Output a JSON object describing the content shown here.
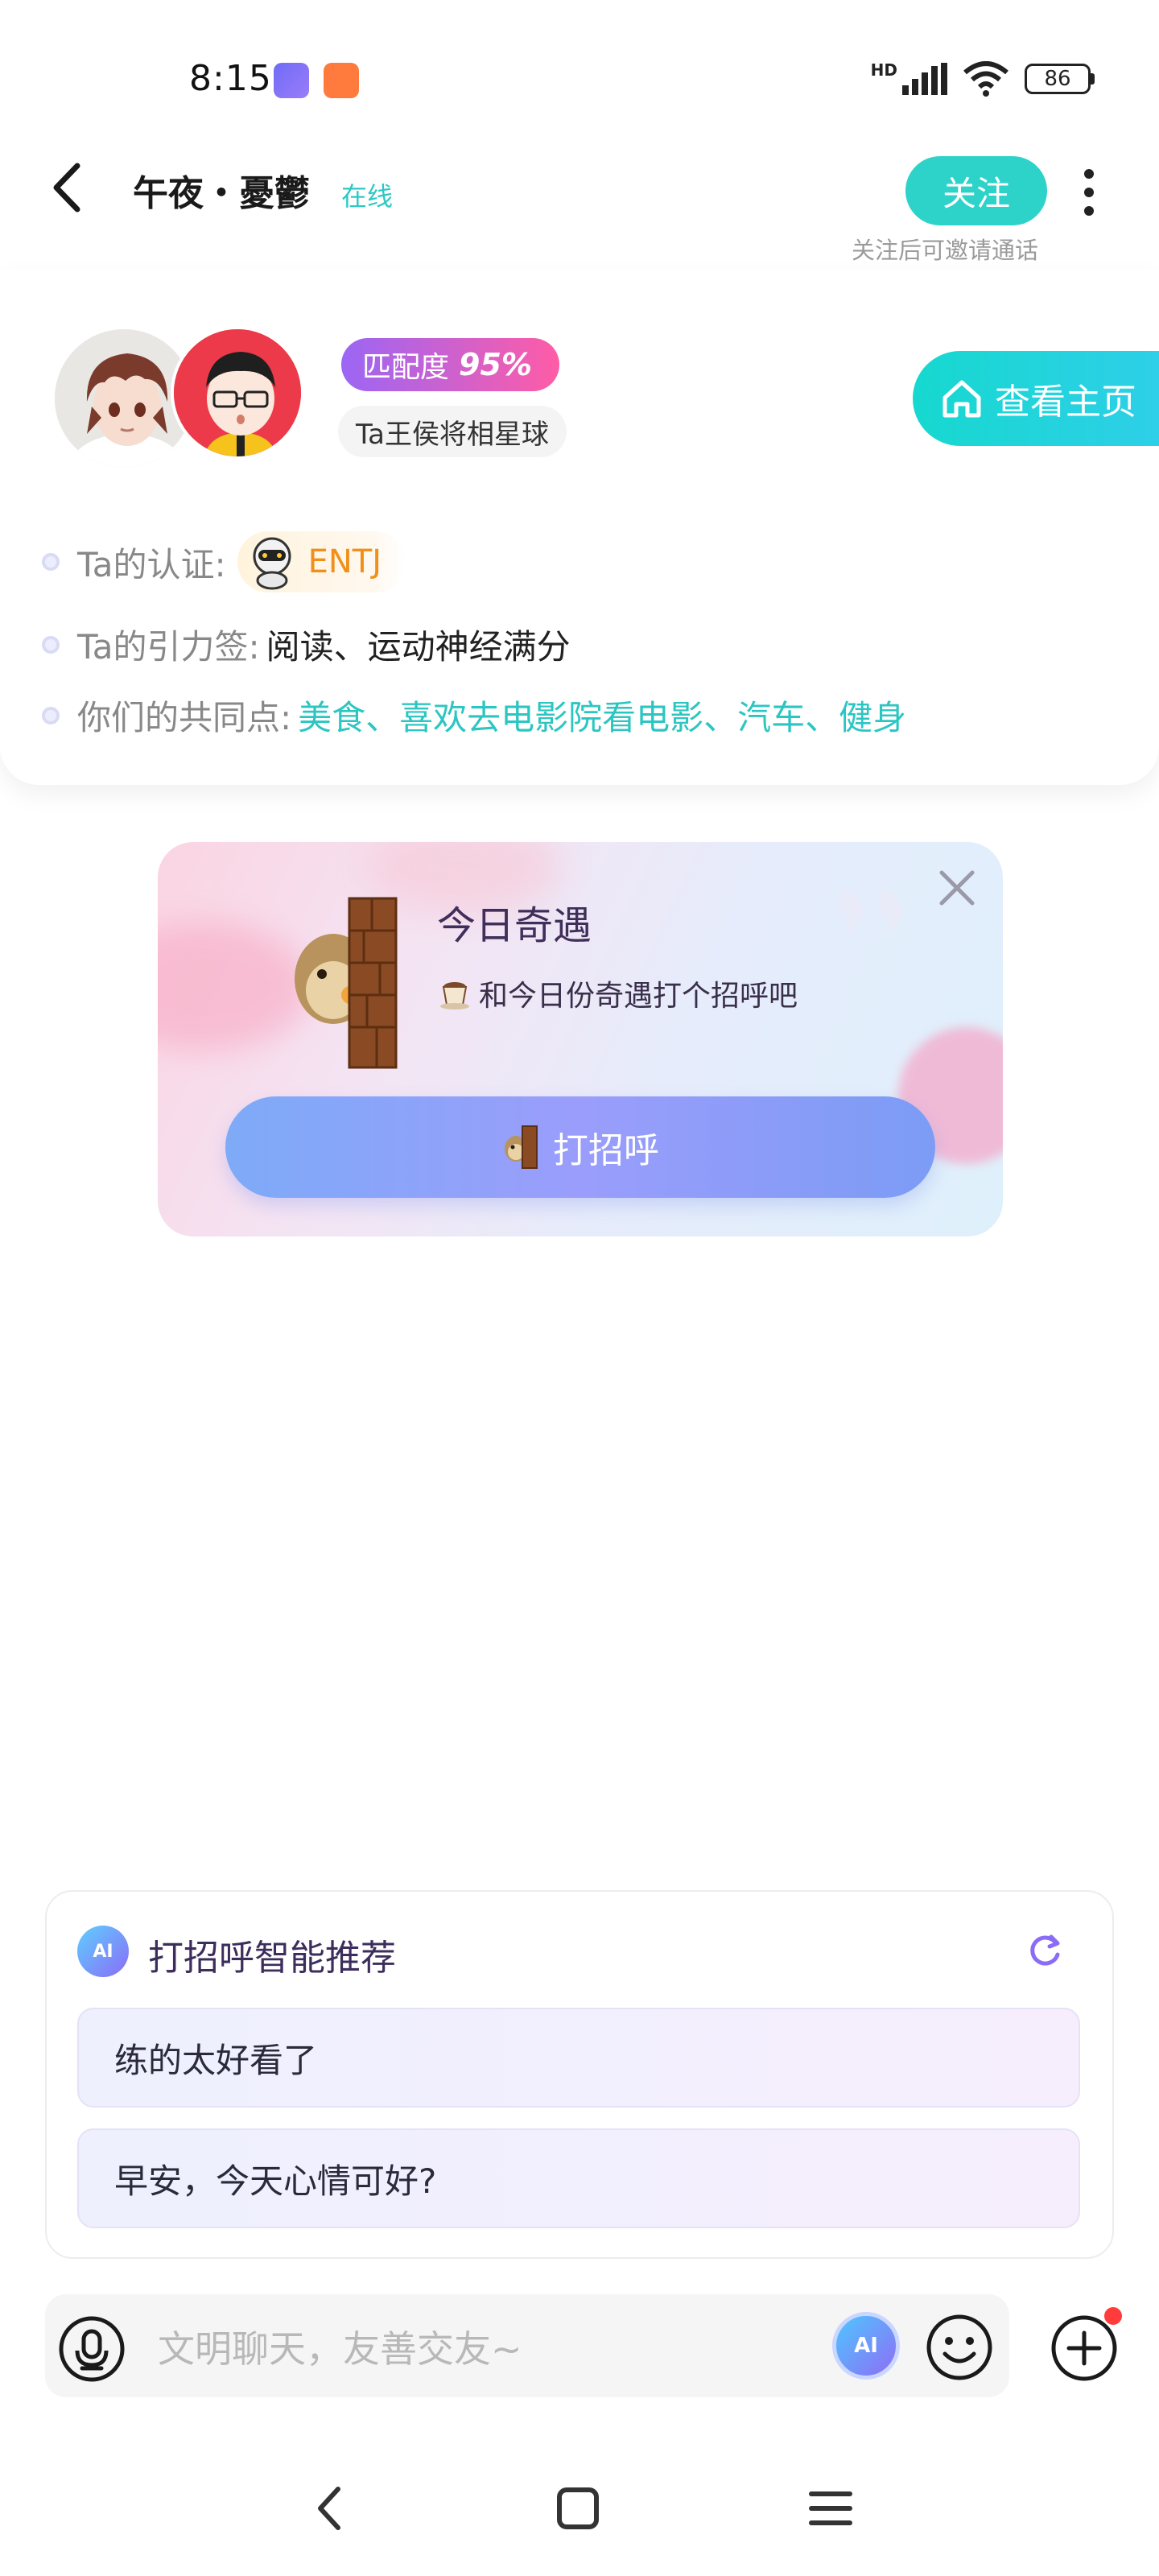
{
  "status_bar": {
    "time": "8:15",
    "network_label": "HD",
    "battery": "86"
  },
  "header": {
    "nickname": "午夜・憂鬱",
    "online_status": "在线",
    "follow_label": "关注",
    "follow_hint": "关注后可邀请通话"
  },
  "profile": {
    "match_label": "匹配度",
    "match_value": "95%",
    "planet_tag": "Ta王侯将相星球",
    "home_button": "查看主页",
    "cert_label": "Ta的认证:",
    "cert_value": "ENTJ",
    "tags_label": "Ta的引力签:",
    "tags_value": "阅读、运动神经满分",
    "common_label": "你们的共同点:",
    "common_value": "美食、喜欢去电影院看电影、汽车、健身"
  },
  "encounter": {
    "title": "今日奇遇",
    "subtitle": "和今日份奇遇打个招呼吧",
    "button": "打招呼"
  },
  "suggestions": {
    "title": "打招呼智能推荐",
    "ai_badge": "AI",
    "items": [
      "练的太好看了",
      "早安，今天心情可好?"
    ]
  },
  "input": {
    "placeholder": "文明聊天，友善交友~",
    "ai_badge": "AI"
  },
  "colors": {
    "accent_teal": "#2dd2c9",
    "match_gradient_start": "#9b66f5",
    "match_gradient_end": "#ff5ca6",
    "mbti_orange": "#f0901a",
    "notification_red": "#ff3b3b"
  }
}
